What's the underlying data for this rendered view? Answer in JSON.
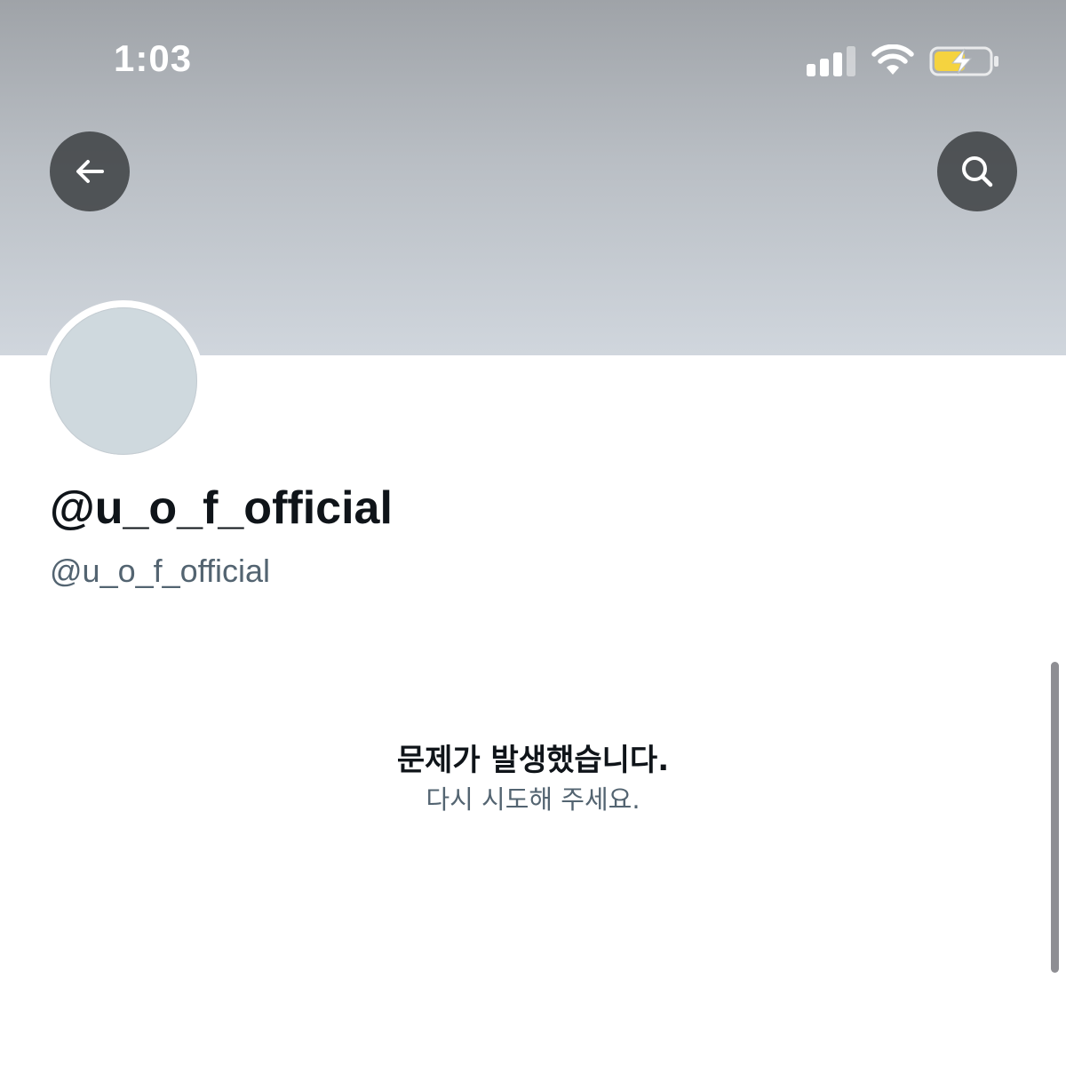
{
  "status_bar": {
    "time": "1:03",
    "icons": [
      "cellular-signal-icon",
      "wifi-icon",
      "battery-charging-icon"
    ]
  },
  "nav": {
    "back_icon": "arrow-left-icon",
    "search_icon": "search-icon"
  },
  "profile": {
    "display_name": "@u_o_f_official",
    "handle": "@u_o_f_official"
  },
  "error": {
    "title": "문제가 발생했습니다.",
    "subtitle": "다시 시도해 주세요."
  },
  "colors": {
    "banner_top": "#9fa3a8",
    "banner_bottom": "#d0d6dd",
    "avatar_placeholder": "#cfd9de",
    "primary_text": "#0f1419",
    "secondary_text": "#536471",
    "battery_fill": "#f5d33f"
  }
}
